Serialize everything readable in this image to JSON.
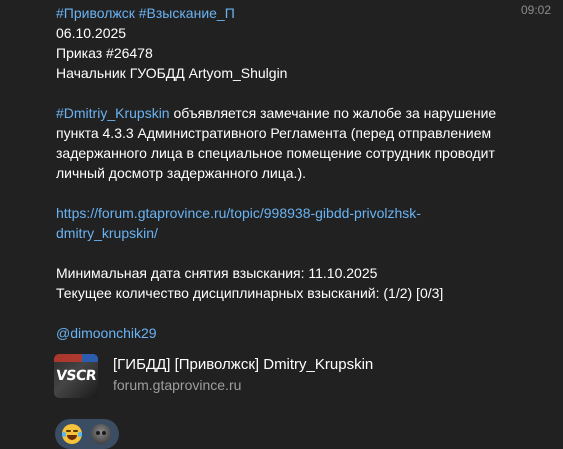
{
  "message": {
    "time": "09:02",
    "hashtag_line": "#Приволжск #Взыскание_П",
    "date": "06.10.2025",
    "order": "Приказ #26478",
    "chief": "Начальник ГУОБДД Artyom_Shulgin",
    "target_tag": "#Dmitriy_Krupskin",
    "reprimand_text": " объявляется замечание по жалобе за нарушение пункта 4.3.3 Административного Регламента (перед отправлением задержанного лица в специальное помещение сотрудник проводит личный досмотр задержанного лица.).",
    "link_line1": "https://forum.gtaprovince.ru/topic/998938-gibdd-privolzhsk-",
    "link_line2": "dmitry_krupskin/",
    "min_date": "Минимальная дата снятия взыскания: 11.10.2025",
    "current_count": "Текущее количество дисциплинарных взысканий: (1/2) [0/3]",
    "mention": "@dimoonchik29"
  },
  "link_preview": {
    "title": "[ГИБДД] [Приволжск] Dmitry_Krupskin",
    "site": "forum.gtaprovince.ru",
    "thumb_logo": "VSCR"
  },
  "reactions": [
    {
      "icon": "laughing-emoji-icon"
    },
    {
      "icon": "user-avatar-icon"
    }
  ],
  "colors": {
    "background": "#212121",
    "link": "#6ab3f3",
    "text": "#ffffff",
    "meta": "#9e9e9e",
    "reaction_bg": "#3a4d63"
  }
}
